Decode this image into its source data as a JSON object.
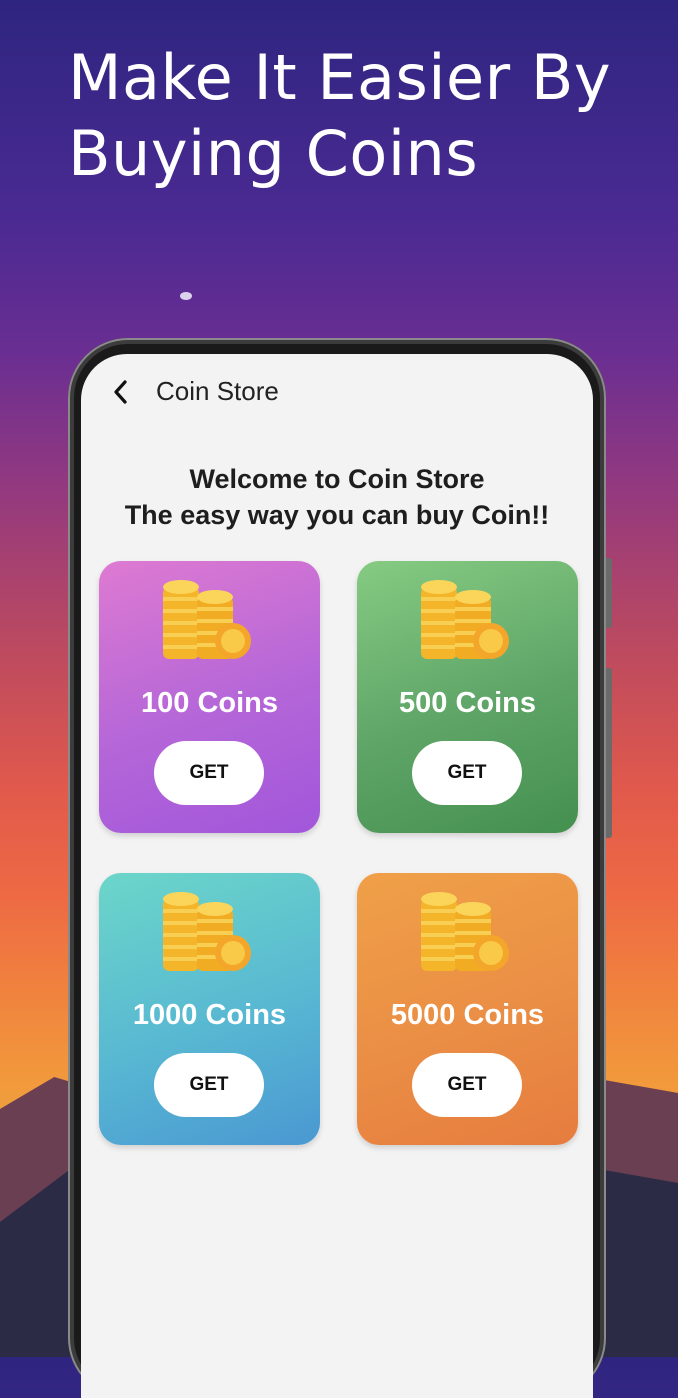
{
  "headline": {
    "line1": "Make It Easier By",
    "line2": "Buying Coins"
  },
  "appbar": {
    "back_icon": "chevron-left-icon",
    "title": "Coin Store"
  },
  "welcome": {
    "line1": "Welcome to Coin Store",
    "line2": "The easy way you can buy Coin!!"
  },
  "packages": [
    {
      "label": "100 Coins",
      "button": "GET",
      "icon": "coin-stack-icon"
    },
    {
      "label": "500 Coins",
      "button": "GET",
      "icon": "coin-stack-icon"
    },
    {
      "label": "1000 Coins",
      "button": "GET",
      "icon": "coin-stack-icon"
    },
    {
      "label": "5000 Coins",
      "button": "GET",
      "icon": "coin-stack-icon"
    }
  ],
  "colors": {
    "card_100": "#b466d8",
    "card_500": "#5ea467",
    "card_1000": "#58b8d2",
    "card_5000": "#ea8e45",
    "coin_gold": "#f6c232"
  }
}
